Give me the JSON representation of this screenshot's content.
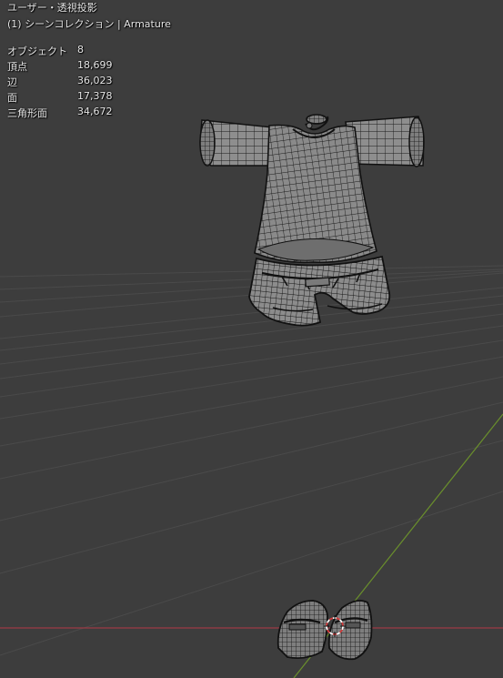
{
  "viewport": {
    "view_name": "ユーザー・透視投影",
    "collection_label": "(1) シーンコレクション | Armature"
  },
  "statistics": [
    {
      "label": "オブジェクト",
      "value": "8"
    },
    {
      "label": "頂点",
      "value": "18,699"
    },
    {
      "label": "辺",
      "value": "36,023"
    },
    {
      "label": "面",
      "value": "17,378"
    },
    {
      "label": "三角形面",
      "value": "34,672"
    }
  ],
  "colors": {
    "background": "#3d3d3d",
    "grid": "#4a4a4a",
    "x_axis": "#9c3b45",
    "y_axis": "#6a8f2c",
    "mesh_fill": "#8e8e8e",
    "wire": "#1a1a1a",
    "cursor_red": "#d23a3a",
    "cursor_white": "#ffffff"
  }
}
